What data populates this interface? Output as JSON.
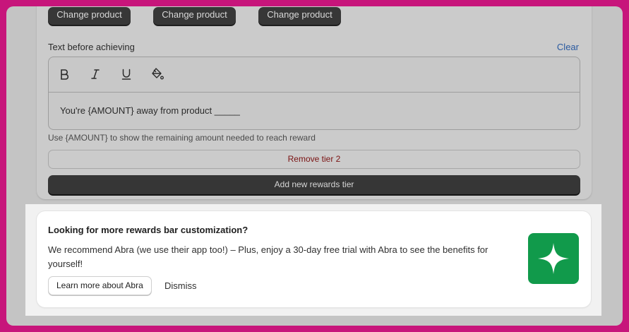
{
  "tier": {
    "change_buttons": [
      "Change product",
      "Change product",
      "Change product"
    ],
    "text_label": "Text before achieving",
    "clear_label": "Clear",
    "editor": {
      "toolbar": [
        "bold-icon",
        "italic-icon",
        "underline-icon",
        "paint-bucket-icon"
      ],
      "content": "You're {AMOUNT} away from product _____"
    },
    "help_text": "Use {AMOUNT} to show the remaining amount needed to reach reward",
    "remove_label": "Remove tier 2",
    "add_label": "Add new rewards tier"
  },
  "promo": {
    "title": "Looking for more rewards bar customization?",
    "body": "We recommend Abra (we use their app too!) – Plus, enjoy a 30-day free trial with Abra to see the benefits for yourself!",
    "learn_label": "Learn more about Abra",
    "dismiss_label": "Dismiss",
    "logo_icon": "sparkle-icon",
    "logo_color": "#119a4b"
  },
  "colors": {
    "background": "#c7157b",
    "link": "#2a5aa0",
    "critical": "#7a1212"
  }
}
